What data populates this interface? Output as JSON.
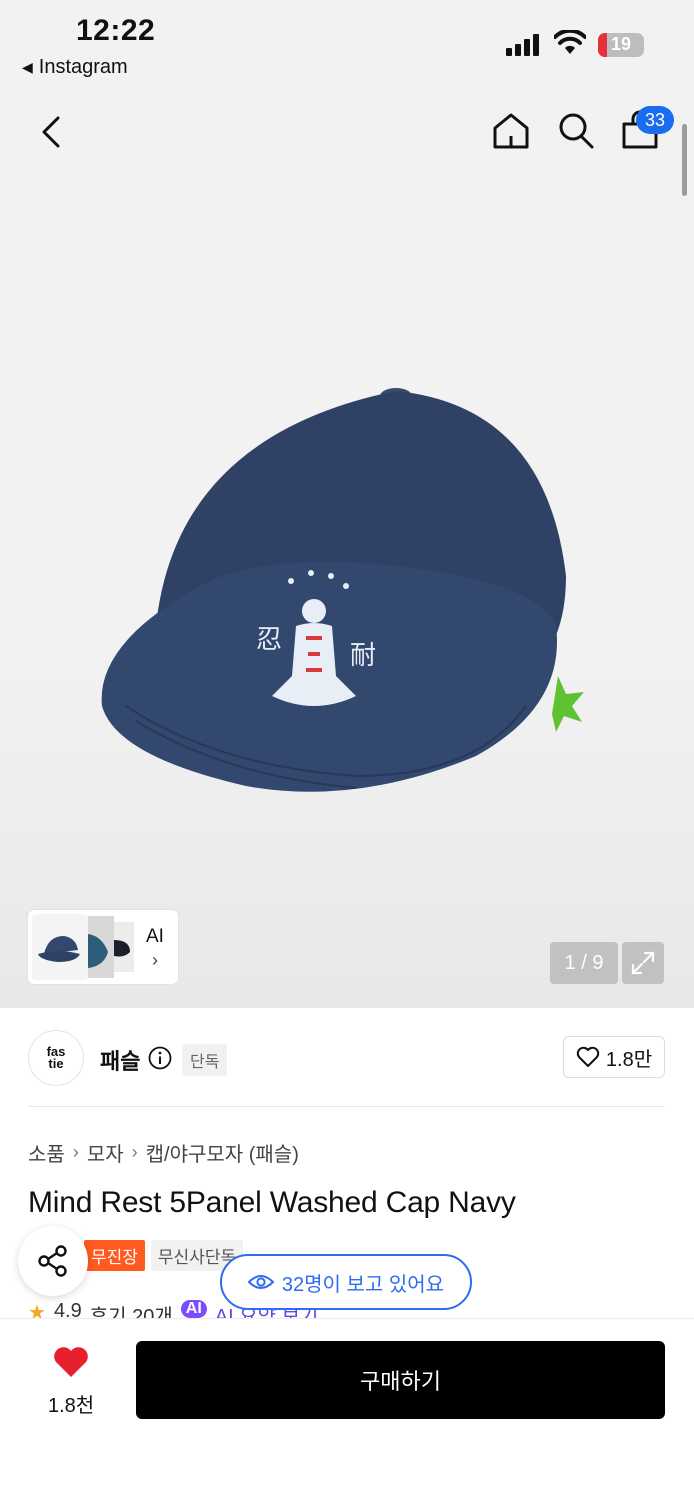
{
  "status_bar": {
    "time": "12:22",
    "back_app": "Instagram",
    "battery": "19"
  },
  "header": {
    "cart_count": "33"
  },
  "gallery": {
    "ai_label": "AI",
    "pager": "1 / 9"
  },
  "brand": {
    "logo_line1": "fas",
    "logo_line2": "tie",
    "name": "패슬",
    "tag": "단독",
    "likes": "1.8만"
  },
  "breadcrumb": [
    "소품",
    "모자",
    "캡/야구모자 (패슬)"
  ],
  "product": {
    "title": "Mind Rest 5Panel Washed Cap Navy",
    "badge_shipping": "무진장",
    "badge_exclusive": "무신사단독",
    "rating": "4.9",
    "reviews": "후기 20개",
    "ai_chip": "AI",
    "ai_summary": "AI 요약 보기"
  },
  "viewers": {
    "text": "32명이 보고 있어요"
  },
  "bottom_bar": {
    "like_count": "1.8천",
    "buy_label": "구매하기"
  },
  "colors": {
    "accent_blue": "#1a6cf0",
    "badge_orange": "#ff5a1f",
    "buy_button": "#000000",
    "heart": "#e8202e"
  }
}
